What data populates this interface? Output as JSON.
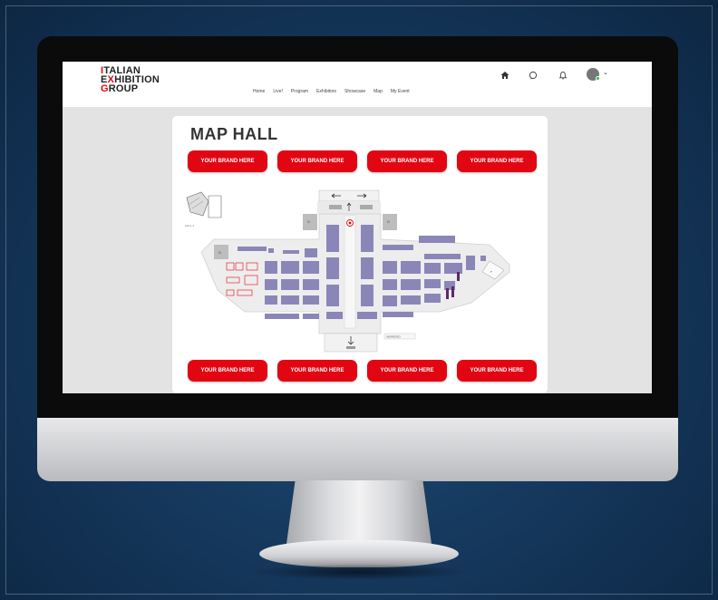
{
  "brand": {
    "logo_line1": "ITALIAN",
    "logo_line2": "EXHIBITION",
    "logo_line3": "GROUP",
    "accent_color": "#e20613"
  },
  "nav": {
    "items": [
      "Home",
      "Live!",
      "Program",
      "Exhibitors",
      "Showcase",
      "Map",
      "My Event"
    ]
  },
  "header_icons": {
    "home": "home-icon",
    "chat": "chat-icon",
    "notifications": "bell-icon",
    "avatar": "avatar",
    "menu": "chevron-down-icon"
  },
  "page": {
    "title": "MAP HALL",
    "brand_label": "YOUR BRAND HERE"
  },
  "map": {
    "legend_text": "HALL 1",
    "entrance_label": "INGRESSO"
  }
}
